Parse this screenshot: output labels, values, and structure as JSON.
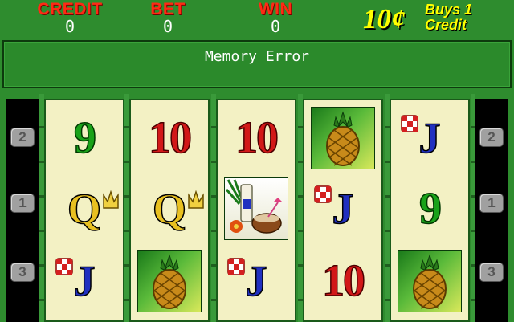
{
  "header": {
    "credit_label": "CREDIT",
    "credit_value": "0",
    "bet_label": "BET",
    "bet_value": "0",
    "win_label": "WIN",
    "win_value": "0",
    "promo_amount": "10¢",
    "promo_text_line1": "Buys 1",
    "promo_text_line2": "Credit"
  },
  "message": "Memory Error",
  "paylines": {
    "left": [
      "2",
      "1",
      "3"
    ],
    "right": [
      "2",
      "1",
      "3"
    ]
  },
  "reels": [
    [
      "9",
      "Q",
      "J"
    ],
    [
      "10",
      "Q",
      "pineapple"
    ],
    [
      "10",
      "cocktail",
      "J"
    ],
    [
      "pineapple",
      "J",
      "10"
    ],
    [
      "J",
      "9",
      "pineapple"
    ]
  ],
  "colors": {
    "background": "#2e8c2e",
    "label_red": "#ff2a14",
    "promo_yellow": "#ffff00",
    "reel_bg": "#f3f1c4"
  }
}
